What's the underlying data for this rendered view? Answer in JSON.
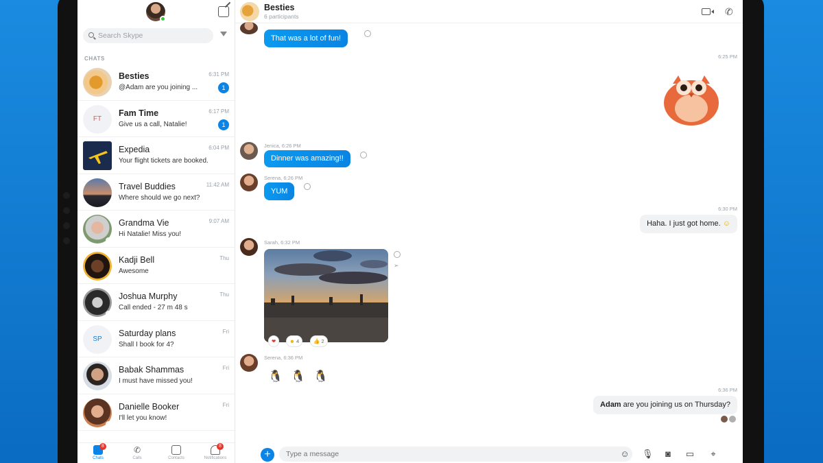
{
  "sidebar": {
    "search_placeholder": "Search Skype",
    "section_label": "CHATS",
    "chats": [
      {
        "name": "Besties",
        "preview": "@Adam are you joining ...",
        "time": "6:31 PM",
        "unread": "1",
        "bold": true
      },
      {
        "name": "Fam Time",
        "preview": "Give us a call, Natalie!",
        "time": "6:17 PM",
        "unread": "1",
        "bold": true,
        "initials": "FT"
      },
      {
        "name": "Expedia",
        "preview": "Your flight tickets are booked.",
        "time": "6:04 PM"
      },
      {
        "name": "Travel Buddies",
        "preview": "Where should we go next?",
        "time": "11:42 AM"
      },
      {
        "name": "Grandma Vie",
        "preview": "Hi Natalie! Miss you!",
        "time": "9:07 AM"
      },
      {
        "name": "Kadji Bell",
        "preview": "Awesome",
        "time": "Thu"
      },
      {
        "name": "Joshua Murphy",
        "preview": "Call ended - 27 m 48 s",
        "time": "Thu"
      },
      {
        "name": "Saturday plans",
        "preview": "Shall I book for 4?",
        "time": "Fri",
        "initials": "SP"
      },
      {
        "name": "Babak Shammas",
        "preview": "I must have missed you!",
        "time": "Fri"
      },
      {
        "name": "Danielle Booker",
        "preview": "I'll let you know!",
        "time": "Fri"
      }
    ],
    "nav": [
      {
        "label": "Chats",
        "badge": "8"
      },
      {
        "label": "Calls"
      },
      {
        "label": "Contacts"
      },
      {
        "label": "Notifications",
        "badge": "8"
      }
    ]
  },
  "conversation": {
    "title": "Besties",
    "subtitle": "6 participants",
    "messages": {
      "m1_text": "That was a lot of fun!",
      "m2_time": "6:25 PM",
      "m3_meta": "Jenica, 6:26 PM",
      "m3_text": "Dinner was amazing!!",
      "m4_meta": "Serena, 6:26 PM",
      "m4_text": "YUM",
      "m5_time": "6:30 PM",
      "m5_text": "Haha. I just got home.",
      "m6_meta": "Sarah, 6:32 PM",
      "m6_reactions": [
        "",
        "4",
        "2"
      ],
      "m7_meta": "Serena, 6:36 PM",
      "m8_time": "6:36 PM",
      "m8_mention": "Adam",
      "m8_text": " are you joining us on Thursday?"
    },
    "composer_placeholder": "Type a message"
  },
  "colors": {
    "accent": "#0b84e6",
    "online": "#2ecc40",
    "badge": "#e5352b"
  }
}
